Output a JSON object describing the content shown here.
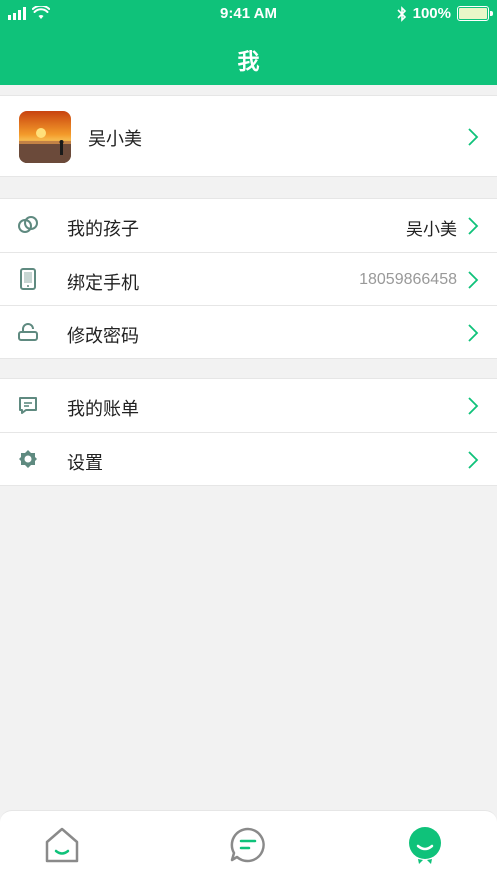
{
  "status_bar": {
    "time": "9:41 AM",
    "battery": "100%"
  },
  "header": {
    "title": "我"
  },
  "profile": {
    "name": "吴小美"
  },
  "group1": [
    {
      "label": "我的孩子",
      "value": "吴小美",
      "icon": "children-icon"
    },
    {
      "label": "绑定手机",
      "value": "18059866458",
      "icon": "phone-icon"
    },
    {
      "label": "修改密码",
      "value": "",
      "icon": "lock-icon"
    }
  ],
  "group2": [
    {
      "label": "我的账单",
      "value": "",
      "icon": "bill-icon"
    },
    {
      "label": "设置",
      "value": "",
      "icon": "settings-icon"
    }
  ],
  "tabs": [
    {
      "name": "home",
      "icon": "home-icon",
      "active": false
    },
    {
      "name": "messages",
      "icon": "message-icon",
      "active": false
    },
    {
      "name": "me",
      "icon": "me-icon",
      "active": true
    }
  ],
  "colors": {
    "accent": "#0fc27a",
    "background": "#f2f2f2",
    "inactive_tab": "#8a8a8a"
  }
}
